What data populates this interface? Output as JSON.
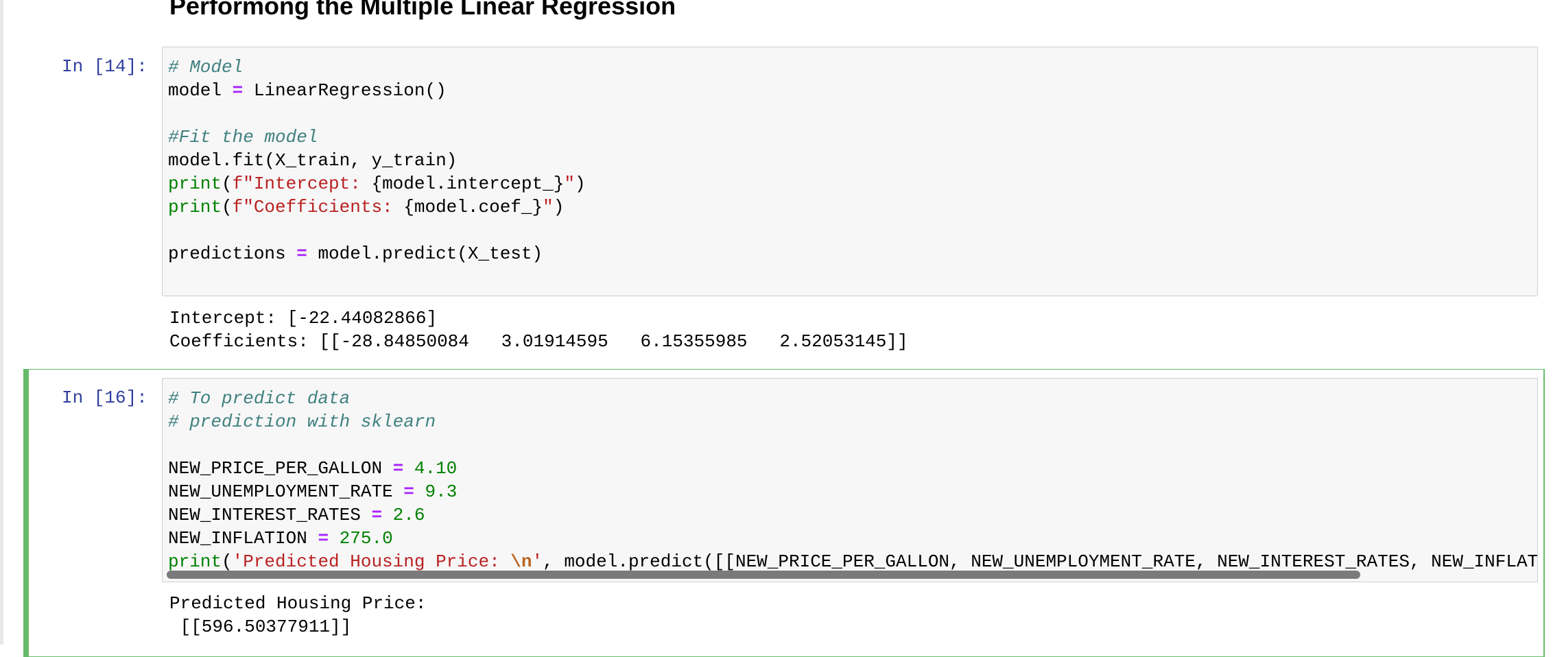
{
  "heading": "Performong the Multiple Linear Regression",
  "cells": [
    {
      "prompt": "In [14]:",
      "code_lines": [
        [
          {
            "t": "# Model",
            "k": "c"
          }
        ],
        [
          {
            "t": "model ",
            "k": ""
          },
          {
            "t": "=",
            "k": "o"
          },
          {
            "t": " LinearRegression()",
            "k": ""
          }
        ],
        [
          {
            "t": "",
            "k": ""
          }
        ],
        [
          {
            "t": "#Fit the model",
            "k": "c"
          }
        ],
        [
          {
            "t": "model.fit(X_train, y_train)",
            "k": ""
          }
        ],
        [
          {
            "t": "print",
            "k": "b"
          },
          {
            "t": "(",
            "k": ""
          },
          {
            "t": "f\"Intercept: ",
            "k": "s"
          },
          {
            "t": "{model.intercept_}",
            "k": ""
          },
          {
            "t": "\"",
            "k": "s"
          },
          {
            "t": ")",
            "k": ""
          }
        ],
        [
          {
            "t": "print",
            "k": "b"
          },
          {
            "t": "(",
            "k": ""
          },
          {
            "t": "f\"Coefficients: ",
            "k": "s"
          },
          {
            "t": "{model.coef_}",
            "k": ""
          },
          {
            "t": "\"",
            "k": "s"
          },
          {
            "t": ")",
            "k": ""
          }
        ],
        [
          {
            "t": "",
            "k": ""
          }
        ],
        [
          {
            "t": "predictions ",
            "k": ""
          },
          {
            "t": "=",
            "k": "o"
          },
          {
            "t": " model.predict(X_test)",
            "k": ""
          }
        ]
      ],
      "output_lines": [
        "Intercept: [-22.44082866]",
        "Coefficients: [[-28.84850084   3.01914595   6.15355985   2.52053145]]"
      ]
    },
    {
      "prompt": "In [16]:",
      "code_lines": [
        [
          {
            "t": "# To predict data",
            "k": "c"
          }
        ],
        [
          {
            "t": "# prediction with sklearn",
            "k": "c"
          }
        ],
        [
          {
            "t": "",
            "k": ""
          }
        ],
        [
          {
            "t": "NEW_PRICE_PER_GALLON ",
            "k": ""
          },
          {
            "t": "=",
            "k": "o"
          },
          {
            "t": " ",
            "k": ""
          },
          {
            "t": "4.10",
            "k": "n"
          }
        ],
        [
          {
            "t": "NEW_UNEMPLOYMENT_RATE ",
            "k": ""
          },
          {
            "t": "=",
            "k": "o"
          },
          {
            "t": " ",
            "k": ""
          },
          {
            "t": "9.3",
            "k": "n"
          }
        ],
        [
          {
            "t": "NEW_INTEREST_RATES ",
            "k": ""
          },
          {
            "t": "=",
            "k": "o"
          },
          {
            "t": " ",
            "k": ""
          },
          {
            "t": "2.6",
            "k": "n"
          }
        ],
        [
          {
            "t": "NEW_INFLATION ",
            "k": ""
          },
          {
            "t": "=",
            "k": "o"
          },
          {
            "t": " ",
            "k": ""
          },
          {
            "t": "275.0",
            "k": "n"
          }
        ],
        [
          {
            "t": "print",
            "k": "b"
          },
          {
            "t": "(",
            "k": ""
          },
          {
            "t": "'Predicted Housing Price: ",
            "k": "s"
          },
          {
            "t": "\\n",
            "k": "se"
          },
          {
            "t": "'",
            "k": "s"
          },
          {
            "t": ", model.predict([[NEW_PRICE_PER_GALLON, NEW_UNEMPLOYMENT_RATE, NEW_INTEREST_RATES, NEW_INFLATION]]))",
            "k": ""
          }
        ]
      ],
      "output_lines": [
        "Predicted Housing Price: ",
        " [[596.50377911]]"
      ]
    }
  ]
}
